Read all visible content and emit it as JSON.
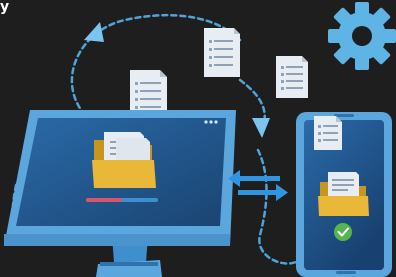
{
  "edge_text": "y",
  "colors": {
    "background": "#1e1e1f",
    "dashed_path": "#4fa3d9",
    "gear": "#5fb4e6",
    "monitor_frame": "#5ba7dd",
    "screen": "#1f4f82",
    "folder": "#e9b838",
    "progress_filled": "#d9546a",
    "progress_empty": "#3e8fd0",
    "transfer_arrows": "#2e95e0",
    "phone_frame": "#5ba7dd",
    "check_badge": "#56b54f"
  },
  "icons": [
    "gear-icon",
    "monitor-icon",
    "phone-icon",
    "folder-icon",
    "document-icon",
    "transfer-arrows-icon",
    "check-icon"
  ],
  "transfer_progress": 0.5,
  "sync_status": "complete"
}
